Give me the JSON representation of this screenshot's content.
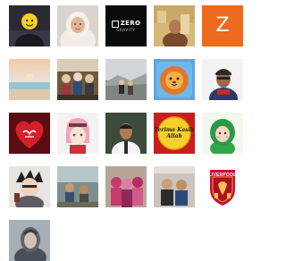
{
  "avatars": [
    {
      "label": "Profile photo"
    },
    {
      "label": "Profile photo"
    },
    {
      "label": "ZERO GRAVITY logo",
      "brand_word": "ZERO",
      "brand_sub": "GRAVITY"
    },
    {
      "label": "Profile photo"
    },
    {
      "label": "Letter avatar",
      "letter": "Z",
      "color": "#ee6a1c"
    },
    {
      "label": "Profile photo"
    },
    {
      "label": "Profile photo"
    },
    {
      "label": "Profile photo"
    },
    {
      "label": "Lion illustration"
    },
    {
      "label": "Profile photo"
    },
    {
      "label": "Heart calligraphy image"
    },
    {
      "label": "Anime avatar"
    },
    {
      "label": "Profile photo"
    },
    {
      "label": "Yellow badge",
      "badge_text": "Terima Kasih Allah"
    },
    {
      "label": "Cartoon avatar"
    },
    {
      "label": "Anime avatar"
    },
    {
      "label": "Profile photo"
    },
    {
      "label": "Profile photo"
    },
    {
      "label": "Profile photo"
    },
    {
      "label": "Liverpool FC crest",
      "crest_text": "LIVERPOOL"
    },
    {
      "label": "Profile photo"
    }
  ]
}
